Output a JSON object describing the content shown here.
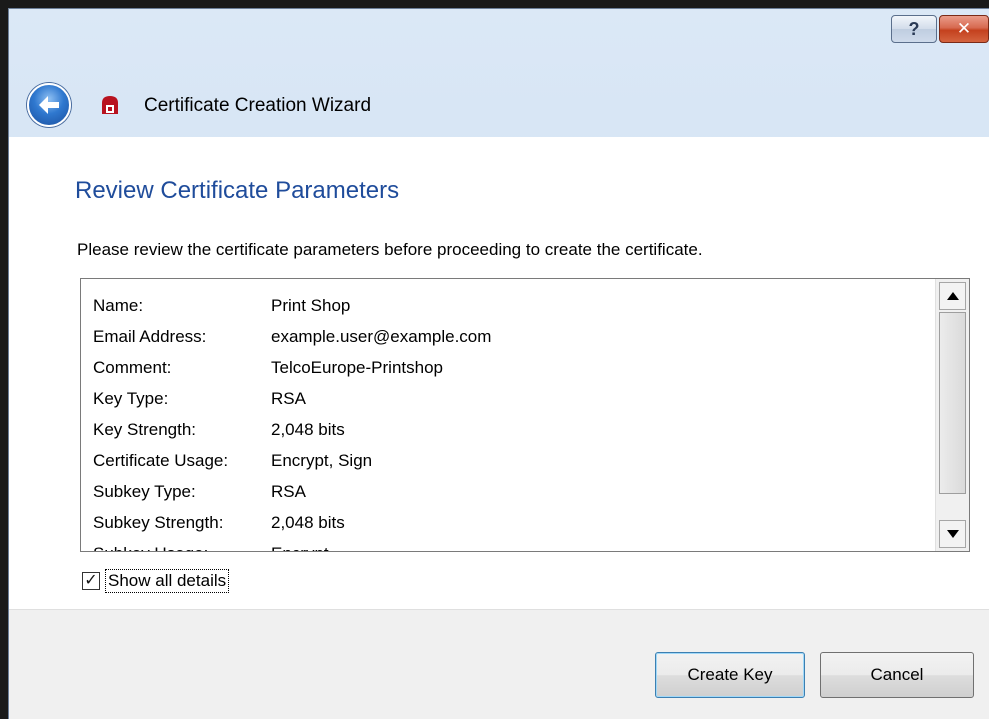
{
  "window": {
    "title": "Certificate Creation Wizard",
    "help_glyph": "?",
    "close_glyph": "✕"
  },
  "page": {
    "heading": "Review Certificate Parameters",
    "instruction": "Please review the certificate parameters before proceeding to create the certificate."
  },
  "details": {
    "rows": [
      {
        "label": "Name:",
        "value": "Print Shop"
      },
      {
        "label": "Email Address:",
        "value": "example.user@example.com"
      },
      {
        "label": "Comment:",
        "value": "TelcoEurope-Printshop"
      },
      {
        "label": "Key Type:",
        "value": "RSA"
      },
      {
        "label": "Key Strength:",
        "value": "2,048 bits"
      },
      {
        "label": "Certificate Usage:",
        "value": "Encrypt, Sign"
      },
      {
        "label": "Subkey Type:",
        "value": "RSA"
      },
      {
        "label": "Subkey Strength:",
        "value": "2,048 bits"
      },
      {
        "label": "Subkey Usage:",
        "value": "Encrypt"
      }
    ]
  },
  "show_details": {
    "label": "Show all details",
    "checked": true,
    "check_glyph": "✓"
  },
  "buttons": {
    "create": "Create Key",
    "cancel": "Cancel"
  }
}
